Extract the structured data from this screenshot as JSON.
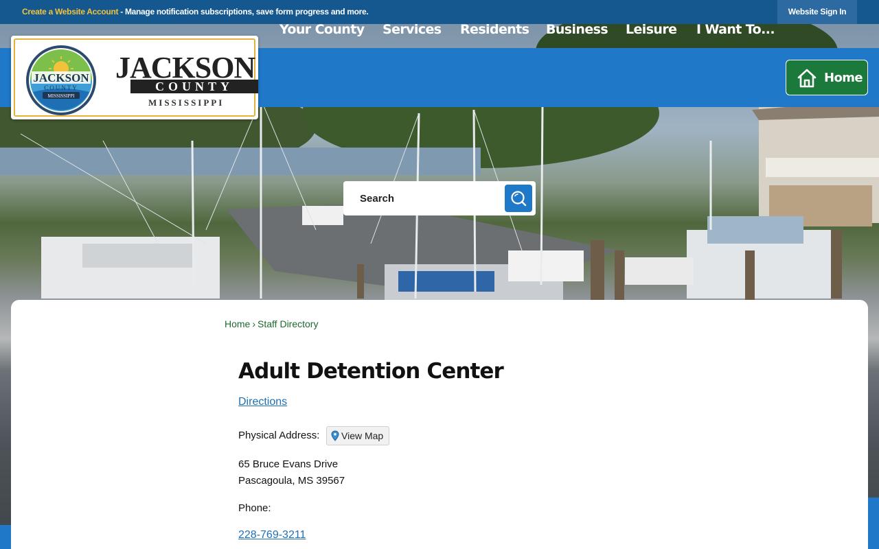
{
  "topbar": {
    "create_account_link": "Create a Website Account",
    "message": " - Manage notification subscriptions, save form progress and more.",
    "sign_in": "Website Sign In"
  },
  "logo": {
    "seal_top": "JACKSON",
    "seal_mid": "COUNTY",
    "seal_bottom": "MISSISSIPPI",
    "word_1": "JACKSON",
    "word_2": "COUNTY",
    "word_3": "MISSISSIPPI"
  },
  "nav": {
    "items": [
      {
        "label": "Your County"
      },
      {
        "label": "Services"
      },
      {
        "label": "Residents"
      },
      {
        "label": "Business"
      },
      {
        "label": "Leisure"
      },
      {
        "label": "I Want To..."
      }
    ],
    "home_label": "Home"
  },
  "search": {
    "placeholder": "Search"
  },
  "breadcrumb": {
    "home": "Home",
    "separator": "›",
    "current": "Staff Directory"
  },
  "main": {
    "title": "Adult Detention Center",
    "directions_link": "Directions",
    "physical_address_label": "Physical Address:",
    "view_map_button": "View Map",
    "address_line_1": "65 Bruce Evans Drive",
    "address_line_2": "Pascagoula, MS 39567",
    "phone_label": "Phone:",
    "phone_number": "228-769-3211"
  },
  "colors": {
    "topbar": "#15588f",
    "nav": "#1f78c8",
    "home_button": "#1b7a3b",
    "accent_gold": "#f2c23a",
    "breadcrumb": "#1b6a2f",
    "link": "#1f6fb5"
  },
  "icons": [
    "home-icon",
    "search-icon",
    "map-pin-icon"
  ]
}
